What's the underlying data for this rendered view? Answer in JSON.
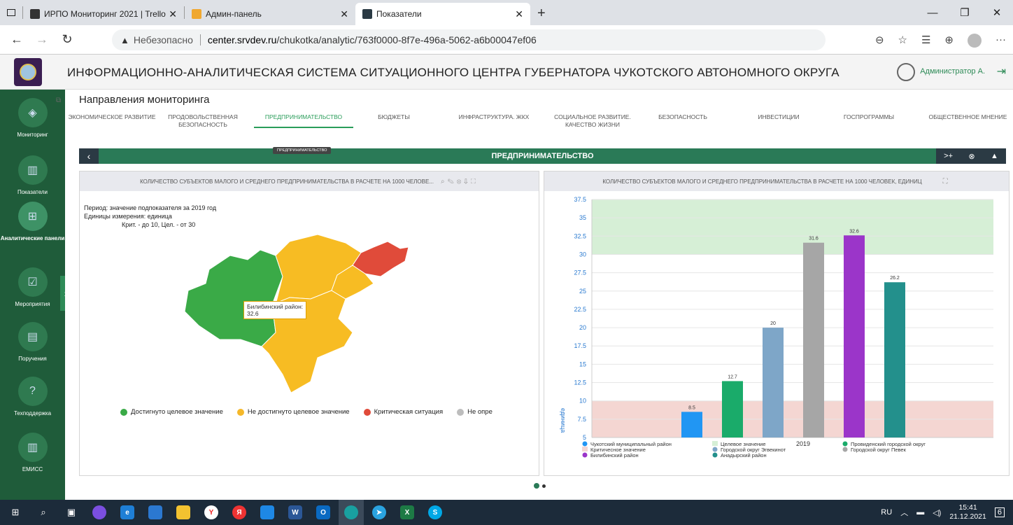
{
  "browser": {
    "tabs": [
      {
        "title": "ИРПО Мониторинг 2021 | Trello",
        "active": false
      },
      {
        "title": "Админ-панель",
        "active": false
      },
      {
        "title": "Показатели",
        "active": true
      }
    ],
    "insecure_label": "Небезопасно",
    "url_host": "center.srvdev.ru",
    "url_path": "/chukotka/analytic/763f0000-8f7e-496a-5062-a6b00047ef06"
  },
  "header": {
    "title": "ИНФОРМАЦИОННО-АНАЛИТИЧЕСКАЯ СИСТЕМА СИТУАЦИОННОГО ЦЕНТРА ГУБЕРНАТОРА ЧУКОТСКОГО АВТОНОМНОГО ОКРУГА",
    "user": "Администратор А."
  },
  "sidebar": {
    "items": [
      {
        "label": "Мониторинг",
        "icon": "shield-icon"
      },
      {
        "label": "Показатели",
        "icon": "bar-chart-icon"
      },
      {
        "label": "Аналитические панели",
        "icon": "grid-icon"
      },
      {
        "label": "Мероприятия",
        "icon": "calendar-icon"
      },
      {
        "label": "Поручения",
        "icon": "briefcase-icon"
      },
      {
        "label": "Техподдержка",
        "icon": "help-icon"
      },
      {
        "label": "ЕМИСС",
        "icon": "bar-chart-icon"
      }
    ]
  },
  "main": {
    "section_title": "Направления мониторинга",
    "tabs": [
      "ЭКОНОМИЧЕСКОЕ РАЗВИТИЕ",
      "ПРОДОВОЛЬСТВЕННАЯ БЕЗОПАСНОСТЬ",
      "ПРЕДПРИНИМАТЕЛЬСТВО",
      "БЮДЖЕТЫ",
      "ИНФРАСТРУКТУРА. ЖКХ",
      "СОЦИАЛЬНОЕ РАЗВИТИЕ. КАЧЕСТВО ЖИЗНИ",
      "БЕЗОПАСНОСТЬ",
      "ИНВЕСТИЦИИ",
      "ГОСПРОГРАММЫ",
      "ОБЩЕСТВЕННОЕ МНЕНИЕ"
    ],
    "active_tab_tooltip": "ПРЕДПРИНИМАТЕЛЬСТВО",
    "panel_title": "ПРЕДПРИНИМАТЕЛЬСТВО",
    "panel_add": ">+"
  },
  "map_card": {
    "title": "КОЛИЧЕСТВО СУБЪЕКТОВ МАЛОГО И СРЕДНЕГО ПРЕДПРИНИМАТЕЛЬСТВА В РАСЧЕТЕ НА 1000 ЧЕЛОВЕ...",
    "period": "Период: значение подпоказателя за 2019 год",
    "units": "Единицы измерения: единица",
    "thresholds": "Крит. - до 10, Цел. - от 30",
    "tooltip_name": "Билибинский район:",
    "tooltip_value": "32.6",
    "legend": [
      {
        "label": "Достигнуто целевое значение",
        "color": "#3aaa47"
      },
      {
        "label": "Не достигнуто целевое значение",
        "color": "#f5b82a"
      },
      {
        "label": "Критическая ситуация",
        "color": "#e04b3a"
      },
      {
        "label": "Не опре",
        "color": "#bdbdbd"
      }
    ],
    "region_colors": {
      "green": "#3aaa47",
      "yellow": "#f7bc23",
      "red": "#e04b3a"
    }
  },
  "chart_card": {
    "title": "КОЛИЧЕСТВО СУБЪЕКТОВ МАЛОГО И СРЕДНЕГО ПРЕДПРИНИМАТЕЛЬСТВА В РАСЧЕТЕ НА 1000 ЧЕЛОВЕК, ЕДИНИЦ"
  },
  "chart_data": {
    "type": "bar",
    "categories": [
      "2019"
    ],
    "ylabel": "единица",
    "ylim": [
      5,
      37.5
    ],
    "yticks": [
      "5",
      "7.5",
      "10",
      "12.5",
      "15",
      "17.5",
      "20",
      "22.5",
      "25",
      "27.5",
      "30",
      "32.5",
      "35",
      "37.5"
    ],
    "target_band": [
      30,
      37.5
    ],
    "critical_band": [
      5,
      10
    ],
    "series": [
      {
        "name": "Чукотский муниципальный район",
        "value": 8.5,
        "label": "8.5",
        "color": "#2196f3"
      },
      {
        "name": "Провиденский городской округ",
        "value": 12.7,
        "label": "12.7",
        "color": "#1aab6a"
      },
      {
        "name": "Городской округ Эгвекинот",
        "value": 20,
        "label": "20",
        "color": "#7ea6c8"
      },
      {
        "name": "Городской округ Певек",
        "value": 31.6,
        "label": "31.6",
        "color": "#a6a6a6"
      },
      {
        "name": "Билибинский район",
        "value": 32.6,
        "label": "32.6",
        "color": "#9b35c9"
      },
      {
        "name": "Анадырский район",
        "value": 26.2,
        "label": "26.2",
        "color": "#23908c"
      }
    ],
    "legend_extra": [
      {
        "name": "Целевое значение",
        "color": "#d6efd6"
      },
      {
        "name": "Критичесное значение",
        "color": "#f4d6d2"
      }
    ],
    "legend_order": [
      "Чукотский муниципальный район",
      "Целевое значение",
      "Провиденский городской округ",
      "Критичесное значение",
      "Городской округ Эгвекинот",
      "Городской округ Певек",
      "Билибинский район",
      "Анадырский район"
    ]
  },
  "taskbar": {
    "lang": "RU",
    "time": "15:41",
    "date": "21.12.2021",
    "notifications": "6"
  }
}
